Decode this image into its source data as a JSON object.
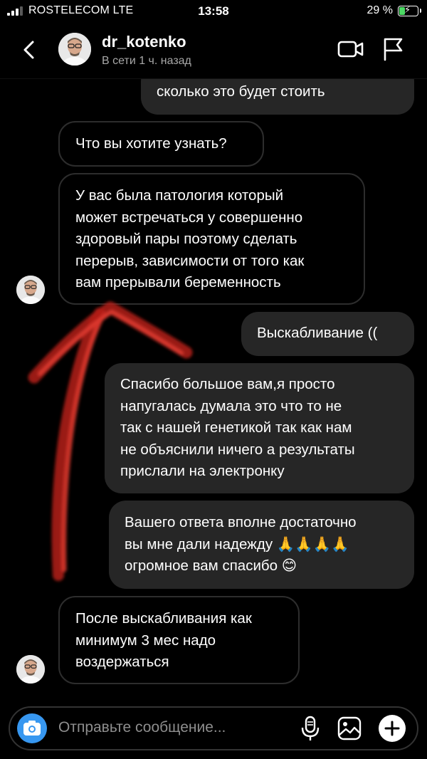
{
  "status_bar": {
    "carrier": "ROSTELECOM  LTE",
    "time": "13:58",
    "battery": "29 %",
    "battery_level": 0.29
  },
  "header": {
    "username": "dr_kotenko",
    "status": "В сети 1 ч. назад"
  },
  "messages": [
    {
      "from": "me",
      "text": "сколько это будет стоить"
    },
    {
      "from": "them",
      "text": "Что вы хотите узнать?"
    },
    {
      "from": "them",
      "text": "У вас была патология который\nможет встречаться у совершенно\nздоровый пары поэтому сделать\nперерыв, зависимости от того как\nвам прерывали беременность"
    },
    {
      "from": "me",
      "text": "Выскабливание (("
    },
    {
      "from": "me",
      "text": "Спасибо большое вам,я просто\nнапугалась думала это что то не\nтак с нашей генетикой так как нам\nне объяснили ничего а результаты\nприслали на электронку"
    },
    {
      "from": "me",
      "text": "Вашего ответа вполне достаточно\nвы мне дали надежду 🙏🙏🙏🙏\nогромное вам спасибо 😊"
    },
    {
      "from": "them",
      "text": "После выскабливания как\nминимум 3 мес надо\nвоздержаться"
    }
  ],
  "composer": {
    "placeholder": "Отправьте сообщение..."
  },
  "colors": {
    "accent": "#3797f0",
    "bubble_out": "#262626",
    "bubble_in_border": "#2d2d2d",
    "arrow": "#d42a22",
    "battery": "#4cd964"
  },
  "icons": [
    "back-chevron-icon",
    "video-call-icon",
    "flag-icon",
    "camera-icon",
    "microphone-icon",
    "gallery-icon",
    "plus-icon"
  ]
}
